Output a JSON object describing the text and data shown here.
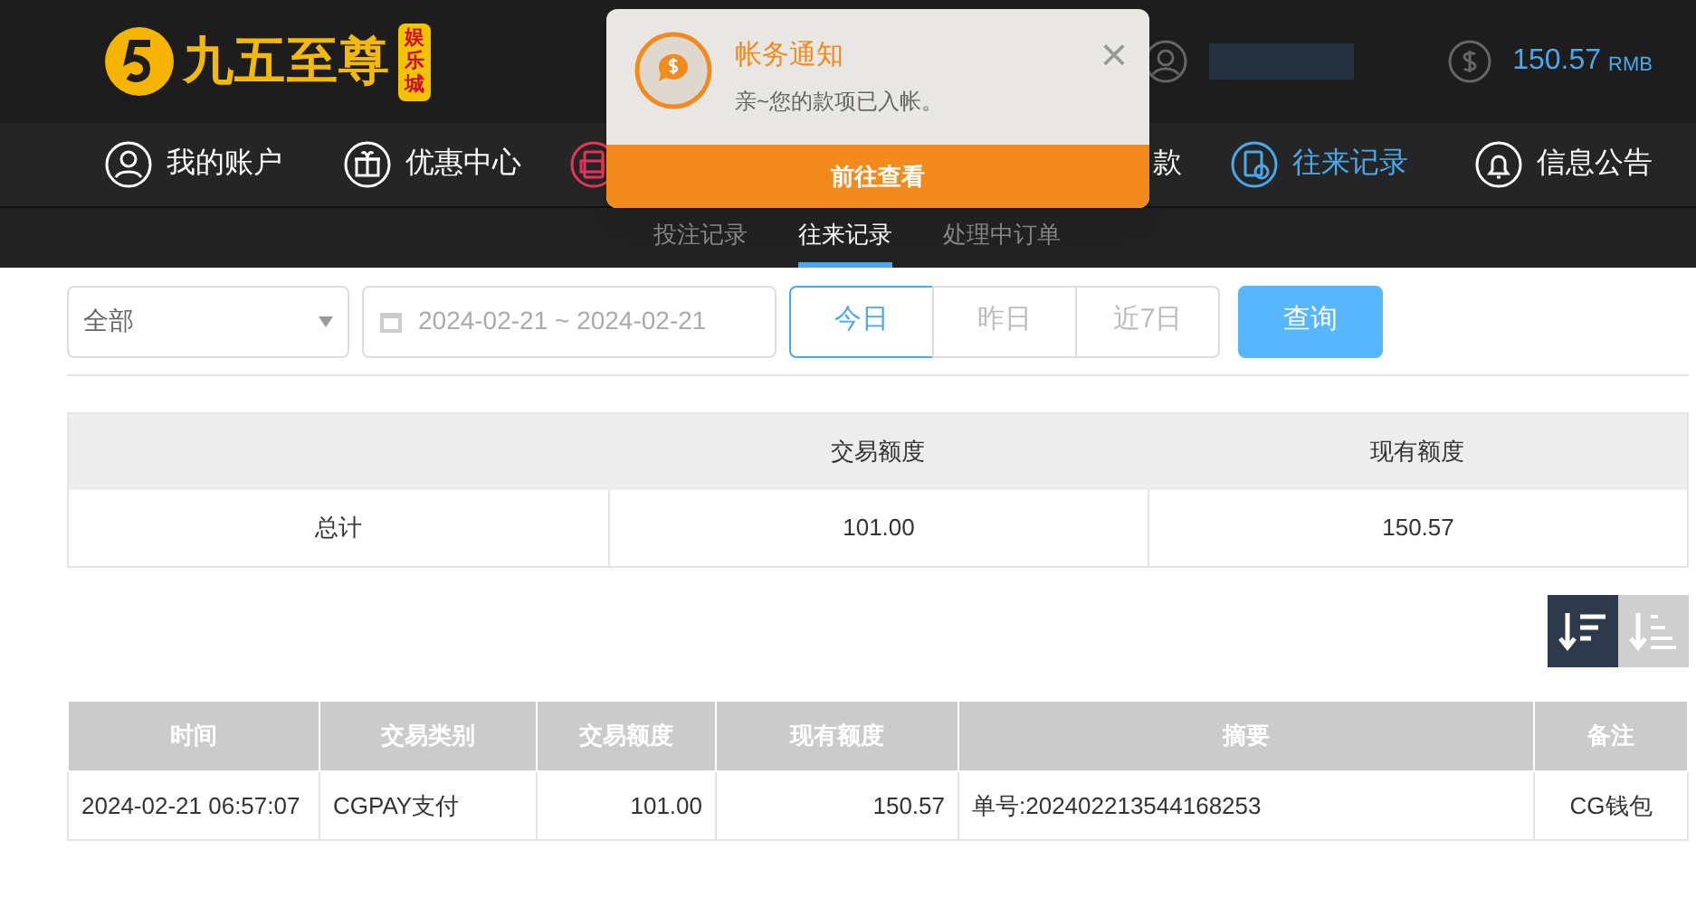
{
  "logo": {
    "title": "九五至尊",
    "badge": "娱乐城"
  },
  "account": {
    "balance": "150.57",
    "currency": "RMB"
  },
  "nav": [
    {
      "label": "我的账户",
      "selected": false
    },
    {
      "label": "优惠中心",
      "selected": false
    },
    {
      "selected": false
    },
    {
      "label": "款",
      "selected": false
    },
    {
      "label": "往来记录",
      "selected": true
    },
    {
      "label": "信息公告",
      "selected": false
    }
  ],
  "subtabs": [
    {
      "label": "投注记录",
      "selected": false
    },
    {
      "label": "往来记录",
      "selected": true
    },
    {
      "label": "处理中订单",
      "selected": false
    }
  ],
  "filters": {
    "type": "全部",
    "date_range": "2024-02-21 ~ 2024-02-21",
    "ranges": [
      {
        "label": "今日",
        "selected": true
      },
      {
        "label": "昨日",
        "selected": false
      },
      {
        "label": "近7日",
        "selected": false
      }
    ],
    "query": "查询"
  },
  "summary": {
    "columns": [
      "交易额度",
      "现有额度"
    ],
    "label": "总计",
    "values": [
      "101.00",
      "150.57"
    ]
  },
  "sort": [
    {
      "selected": true
    },
    {
      "selected": false
    }
  ],
  "table": {
    "columns": [
      "时间",
      "交易类别",
      "交易额度",
      "现有额度",
      "摘要",
      "备注"
    ],
    "rows": [
      [
        "2024-02-21 06:57:07",
        "CGPAY支付",
        "101.00",
        "150.57",
        "单号:202402213544168253",
        "CG钱包"
      ]
    ]
  },
  "notification": {
    "title": "帐务通知",
    "message": "亲~您的款项已入帐。",
    "close": "×",
    "action": "前往查看"
  }
}
